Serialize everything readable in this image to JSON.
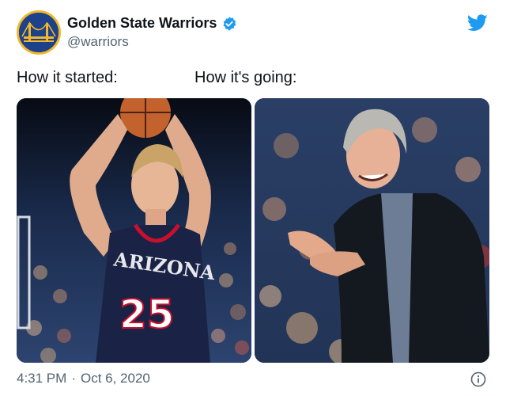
{
  "tweet": {
    "display_name": "Golden State Warriors",
    "handle": "@warriors",
    "caption_left": "How it started:",
    "caption_right": "How it's going:",
    "time": "4:31 PM",
    "separator": "·",
    "date": "Oct 6, 2020"
  },
  "photo_left": {
    "jersey_text": "ARIZONA",
    "jersey_number": "25"
  },
  "icons": {
    "avatar": "warriors-bridge-logo",
    "verified": "verified-badge-icon",
    "brand": "twitter-bird-icon",
    "info": "info-icon"
  },
  "colors": {
    "brand_blue": "#1d9bf0",
    "warriors_blue": "#1d428a",
    "warriors_gold": "#f3b72c",
    "secondary_text": "#536471"
  }
}
